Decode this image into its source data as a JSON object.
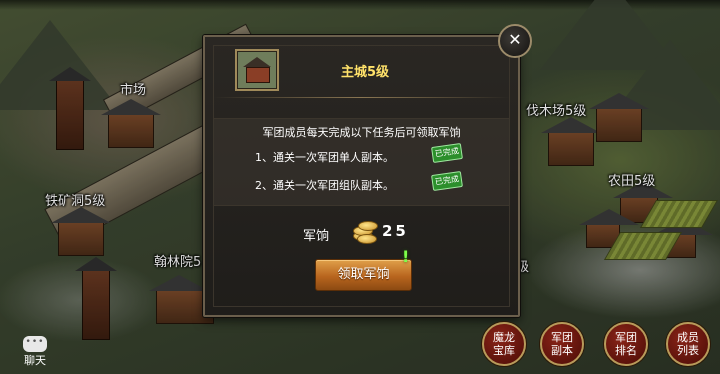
{
  "map": {
    "labels": {
      "market": "市场",
      "iron_mine": "铁矿洞5级",
      "academy": "翰林院5",
      "lumber_yard": "伐木场5级",
      "farmland": "农田5级",
      "partial": "级"
    }
  },
  "dialog": {
    "title": "主城5级",
    "intro": "军团成员每天完成以下任务后可领取军饷",
    "tasks": [
      {
        "text": "1、通关一次军团单人副本。",
        "status": "已完成"
      },
      {
        "text": "2、通关一次军团组队副本。",
        "status": "已完成"
      }
    ],
    "reward_label": "军饷",
    "reward_amount": "25",
    "claim_label": "领取军饷",
    "alert_mark": "!",
    "close_symbol": "✕"
  },
  "bottom_bar": {
    "chat_label": "聊天",
    "buttons": [
      {
        "line1": "魔龙",
        "line2": "宝库"
      },
      {
        "line1": "军团",
        "line2": "副本"
      },
      {
        "line1": "军团",
        "line2": "排名"
      },
      {
        "line1": "成员",
        "line2": "列表"
      }
    ]
  },
  "colors": {
    "title_yellow": "#ffe26a",
    "done_green": "#2c8f2c",
    "button_orange": "#c8762a",
    "round_button_red": "#7a1c12"
  },
  "icons": [
    "close-icon",
    "coin-stack-icon",
    "chat-icon",
    "alert-icon"
  ]
}
